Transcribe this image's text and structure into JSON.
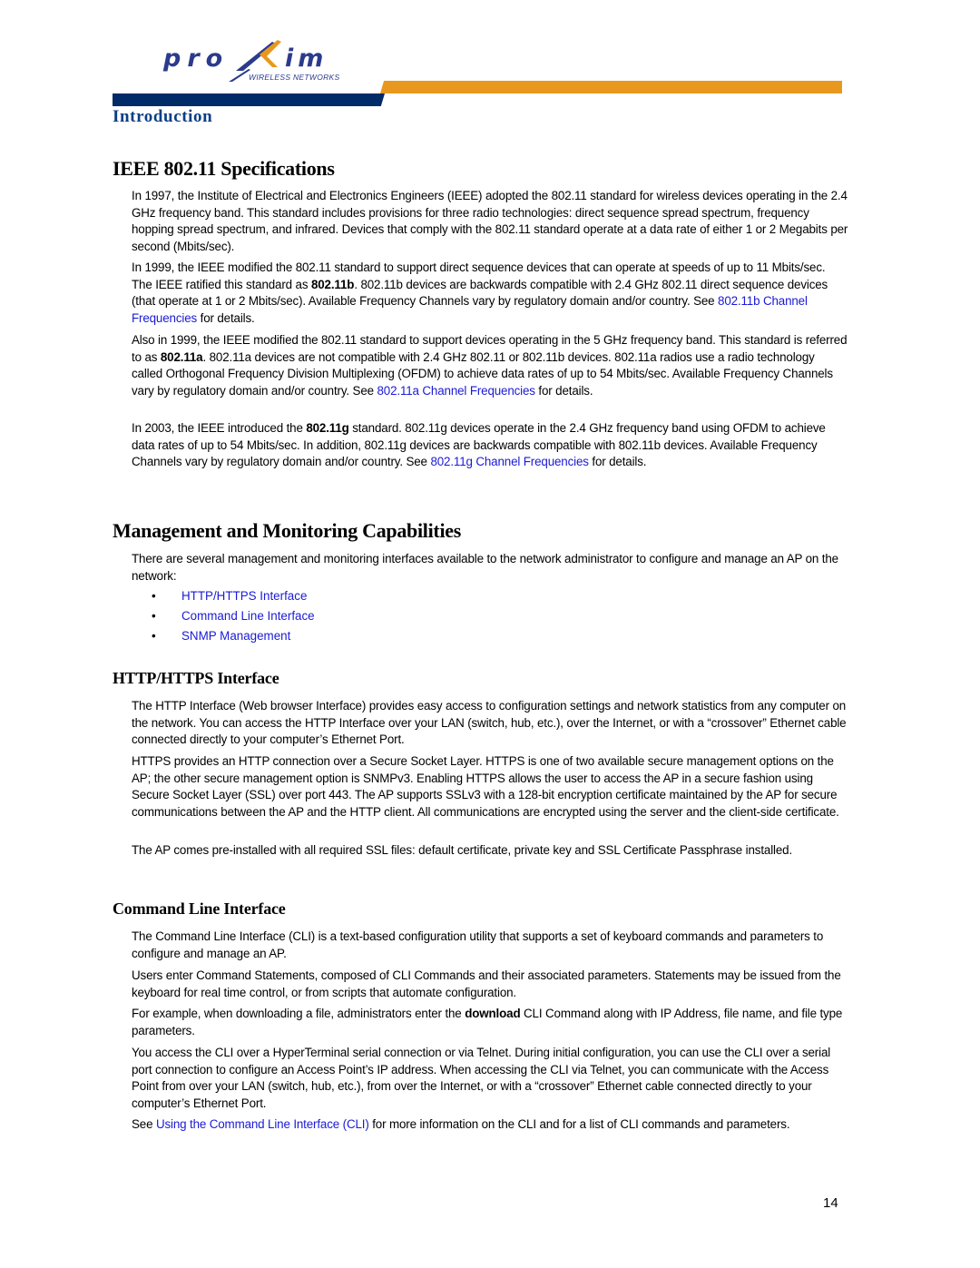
{
  "header": {
    "logo": {
      "wordmark": "proxim",
      "tagline": "WIRELESS NETWORKS",
      "icon": "proxim-logo-icon"
    },
    "section_label": "Introduction",
    "colors": {
      "brand_blue": "#012a68",
      "brand_orange": "#e8981e",
      "section_label": "#0b3f86",
      "link": "#1a1ad6"
    }
  },
  "ieee": {
    "title": "IEEE 802.11 Specifications",
    "p1": "In 1997, the Institute of Electrical and Electronics Engineers (IEEE) adopted the 802.11 standard for wireless devices operating in the 2.4 GHz frequency band. This standard includes provisions for three radio technologies: direct sequence spread spectrum, frequency hopping spread spectrum, and infrared. Devices that comply with the 802.11 standard operate at a data rate of either 1 or 2 Megabits per second (Mbits/sec).",
    "p2": {
      "a": "In 1999, the IEEE modified the 802.11 standard to support direct sequence devices that can operate at speeds of up to 11 Mbits/sec. The IEEE ratified this standard as ",
      "bold": "802.11b",
      "b": ". 802.11b devices are backwards compatible with 2.4 GHz 802.11 direct sequence devices (that operate at 1 or 2 Mbits/sec). Available Frequency Channels vary by regulatory domain and/or country. See ",
      "link": "802.11b Channel Frequencies",
      "c": " for details."
    },
    "p3": {
      "a": "Also in 1999, the IEEE modified the 802.11 standard to support devices operating in the 5 GHz frequency band. This standard is referred to as ",
      "bold": "802.11a",
      "b": ". 802.11a devices are not compatible with 2.4 GHz 802.11 or 802.11b devices. 802.11a radios use a radio technology called Orthogonal Frequency Division Multiplexing (OFDM) to achieve data rates of up to 54 Mbits/sec. Available Frequency Channels vary by regulatory domain and/or country. See ",
      "link": "802.11a Channel Frequencies",
      "c": " for details."
    },
    "p4": {
      "a": "In 2003, the IEEE introduced the ",
      "bold": "802.11g",
      "b": " standard. 802.11g devices operate in the 2.4 GHz frequency band using OFDM to achieve data rates of up to 54 Mbits/sec. In addition, 802.11g devices are backwards compatible with 802.11b devices. Available Frequency Channels vary by regulatory domain and/or country. See ",
      "link": "802.11g Channel Frequencies",
      "c": " for details."
    }
  },
  "management": {
    "title": "Management and Monitoring Capabilities",
    "intro": "There are several management and monitoring interfaces available to the network administrator to configure and manage an AP on the network:",
    "bullet_glyph": "•",
    "links": [
      "HTTP/HTTPS Interface",
      "Command Line Interface",
      "SNMP Management"
    ]
  },
  "http": {
    "title": "HTTP/HTTPS Interface",
    "p1": "The HTTP Interface (Web browser Interface) provides easy access to configuration settings and network statistics from any computer on the network. You can access the HTTP Interface over your LAN (switch, hub, etc.), over the Internet, or with a “crossover” Ethernet cable connected directly to your computer’s Ethernet Port.",
    "p2": "HTTPS provides an HTTP connection over a Secure Socket Layer. HTTPS is one of two available secure management options on the AP; the other secure management option is SNMPv3. Enabling HTTPS allows the user to access the AP in a secure fashion using Secure Socket Layer (SSL) over port 443. The AP supports SSLv3 with a 128-bit encryption certificate maintained by the AP for secure communications between the AP and the HTTP client. All communications are encrypted using the server and the client-side certificate.",
    "p3": "The AP comes pre-installed with all required SSL files: default certificate, private key and SSL Certificate Passphrase installed."
  },
  "cli": {
    "title": "Command Line Interface",
    "p1": "The Command Line Interface (CLI) is a text-based configuration utility that supports a set of keyboard commands and parameters to configure and manage an AP.",
    "p2": "Users enter Command Statements, composed of CLI Commands and their associated parameters. Statements may be issued from the keyboard for real time control, or from scripts that automate configuration.",
    "p3": {
      "a": "For example, when downloading a file, administrators enter the ",
      "bold": "download",
      "b": " CLI Command along with IP Address, file name, and file type parameters."
    },
    "p4": "You access the CLI over a HyperTerminal serial connection or via Telnet. During initial configuration, you can use the CLI over a serial port connection to configure an Access Point’s IP address. When accessing the CLI via Telnet, you can communicate with the Access Point from over your LAN (switch, hub, etc.), from over the Internet, or with a “crossover” Ethernet cable connected directly to your computer’s Ethernet Port.",
    "p5": {
      "a": "See ",
      "link": "Using the Command Line Interface (CLI)",
      "b": " for more information on the CLI and for a list of CLI commands and parameters."
    }
  },
  "footer": {
    "page_number": "14"
  }
}
